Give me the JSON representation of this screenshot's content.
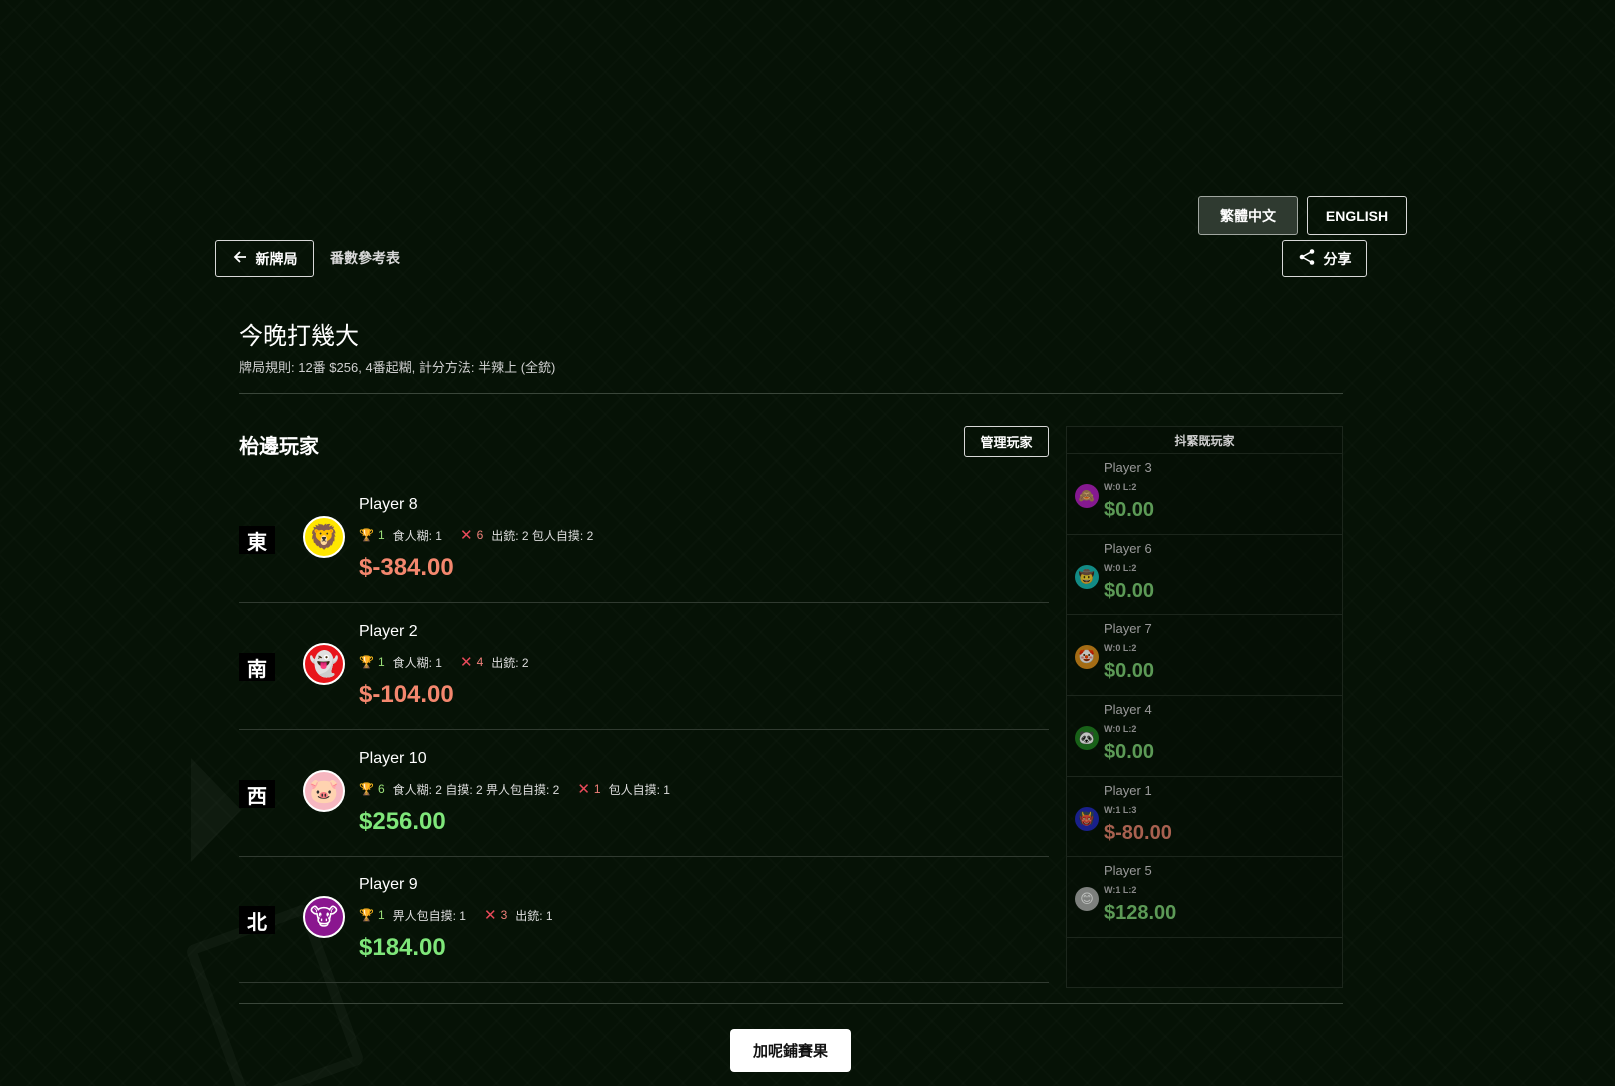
{
  "language": {
    "zh_label": "繁體中文",
    "en_label": "ENGLISH"
  },
  "toolbar": {
    "back_label": "新牌局",
    "reference_label": "番數參考表",
    "share_label": "分享"
  },
  "game": {
    "title": "今晚打幾大",
    "rules": "牌局規則: 12番 $256, 4番起糊, 計分方法: 半辣上 (全銃)"
  },
  "table_players": {
    "title": "枱邊玩家",
    "manage_label": "管理玩家",
    "rows": [
      {
        "seat": "東",
        "avatar": "lion",
        "avatar_glyph": "🦁",
        "avatar_bg": "#ffe600",
        "name": "Player 8",
        "wins": "1",
        "win_detail": "食人糊: 1",
        "losses": "6",
        "loss_detail": "出銃: 2 包人自摸: 2",
        "amount": "$-384.00",
        "sign": "neg"
      },
      {
        "seat": "南",
        "avatar": "ghost",
        "avatar_glyph": "👻",
        "avatar_bg": "#e8151b",
        "name": "Player 2",
        "wins": "1",
        "win_detail": "食人糊: 1",
        "losses": "4",
        "loss_detail": "出銃: 2",
        "amount": "$-104.00",
        "sign": "neg"
      },
      {
        "seat": "西",
        "avatar": "pig",
        "avatar_glyph": "🐷",
        "avatar_bg": "#f6b6c0",
        "name": "Player 10",
        "wins": "6",
        "win_detail": "食人糊: 2 自摸: 2 畀人包自摸: 2",
        "losses": "1",
        "loss_detail": "包人自摸: 1",
        "amount": "$256.00",
        "sign": "pos"
      },
      {
        "seat": "北",
        "avatar": "cow",
        "avatar_glyph": "🐮",
        "avatar_bg": "#8a168f",
        "name": "Player 9",
        "wins": "1",
        "win_detail": "畀人包自摸: 1",
        "losses": "3",
        "loss_detail": "出銃: 1",
        "amount": "$184.00",
        "sign": "pos"
      }
    ]
  },
  "bench": {
    "title": "抖緊既玩家",
    "players": [
      {
        "name": "Player 3",
        "avatar": "monkey",
        "avatar_glyph": "🙈",
        "avatar_bg": "#b01dbf",
        "wl": "W:0  L:2",
        "amount": "$0.00",
        "sign": "pos"
      },
      {
        "name": "Player 6",
        "avatar": "cowboy",
        "avatar_glyph": "🤠",
        "avatar_bg": "#17b5b0",
        "wl": "W:0  L:2",
        "amount": "$0.00",
        "sign": "pos"
      },
      {
        "name": "Player 7",
        "avatar": "clown",
        "avatar_glyph": "🤡",
        "avatar_bg": "#d98b1a",
        "wl": "W:0  L:2",
        "amount": "$0.00",
        "sign": "pos"
      },
      {
        "name": "Player 4",
        "avatar": "panda",
        "avatar_glyph": "🐼",
        "avatar_bg": "#1f7d1f",
        "wl": "W:0  L:2",
        "amount": "$0.00",
        "sign": "pos"
      },
      {
        "name": "Player 1",
        "avatar": "ogre",
        "avatar_glyph": "👹",
        "avatar_bg": "#2026b8",
        "wl": "W:1  L:3",
        "amount": "$-80.00",
        "sign": "neg"
      },
      {
        "name": "Player 5",
        "avatar": "smile",
        "avatar_glyph": "😊",
        "avatar_bg": "#a6a6a6",
        "wl": "W:1  L:2",
        "amount": "$128.00",
        "sign": "pos"
      }
    ]
  },
  "add_result_label": "加呢鋪賽果",
  "colors": {
    "background": "#061206",
    "negative": "#f4876e",
    "positive": "#7fe67a"
  }
}
